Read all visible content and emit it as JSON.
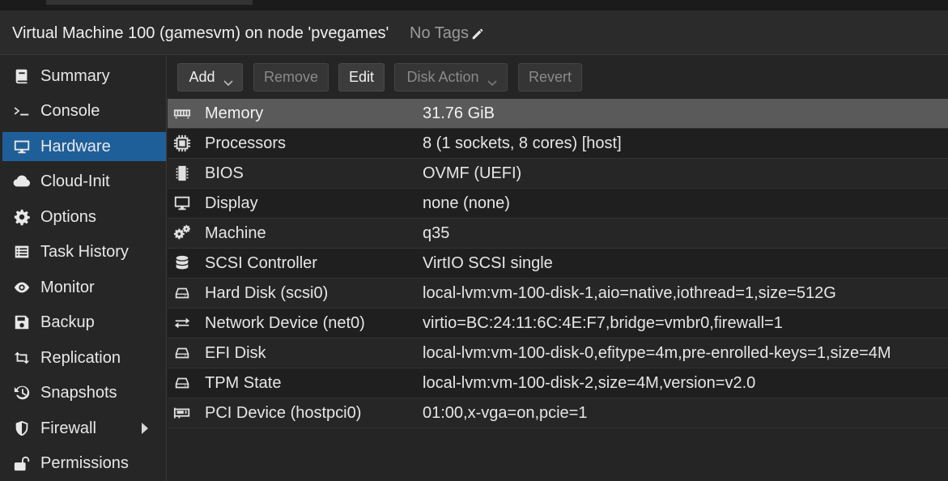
{
  "window": {
    "title": "Virtual Machine 100 (gamesvm) on node 'pvegames'",
    "tags_label": "No Tags"
  },
  "sidebar": {
    "items": [
      {
        "label": "Summary",
        "icon": "book-icon"
      },
      {
        "label": "Console",
        "icon": "terminal-icon"
      },
      {
        "label": "Hardware",
        "icon": "monitor-icon",
        "active": true
      },
      {
        "label": "Cloud-Init",
        "icon": "cloud-icon"
      },
      {
        "label": "Options",
        "icon": "gear-icon"
      },
      {
        "label": "Task History",
        "icon": "list-icon"
      },
      {
        "label": "Monitor",
        "icon": "eye-icon"
      },
      {
        "label": "Backup",
        "icon": "floppy-icon"
      },
      {
        "label": "Replication",
        "icon": "retweet-icon"
      },
      {
        "label": "Snapshots",
        "icon": "history-icon"
      },
      {
        "label": "Firewall",
        "icon": "shield-icon",
        "expandable": true
      },
      {
        "label": "Permissions",
        "icon": "unlock-icon"
      }
    ]
  },
  "toolbar": {
    "add_label": "Add",
    "remove_label": "Remove",
    "edit_label": "Edit",
    "disk_action_label": "Disk Action",
    "revert_label": "Revert"
  },
  "hardware": {
    "rows": [
      {
        "key": "Memory",
        "value": "31.76 GiB",
        "icon": "memory-icon",
        "selected": true
      },
      {
        "key": "Processors",
        "value": "8 (1 sockets, 8 cores) [host]",
        "icon": "cpu-icon"
      },
      {
        "key": "BIOS",
        "value": "OVMF (UEFI)",
        "icon": "chip-icon"
      },
      {
        "key": "Display",
        "value": "none (none)",
        "icon": "desktop-icon"
      },
      {
        "key": "Machine",
        "value": "q35",
        "icon": "cogs-icon"
      },
      {
        "key": "SCSI Controller",
        "value": "VirtIO SCSI single",
        "icon": "database-icon"
      },
      {
        "key": "Hard Disk (scsi0)",
        "value": "local-lvm:vm-100-disk-1,aio=native,iothread=1,size=512G",
        "icon": "hdd-icon"
      },
      {
        "key": "Network Device (net0)",
        "value": "virtio=BC:24:11:6C:4E:F7,bridge=vmbr0,firewall=1",
        "icon": "exchange-icon"
      },
      {
        "key": "EFI Disk",
        "value": "local-lvm:vm-100-disk-0,efitype=4m,pre-enrolled-keys=1,size=4M",
        "icon": "hdd-icon"
      },
      {
        "key": "TPM State",
        "value": "local-lvm:vm-100-disk-2,size=4M,version=v2.0",
        "icon": "hdd-icon"
      },
      {
        "key": "PCI Device (hostpci0)",
        "value": "01:00,x-vga=on,pcie=1",
        "icon": "pci-card-icon"
      }
    ]
  },
  "colors": {
    "active_nav": "#1f5f99",
    "selected_row": "#5a5a5a"
  }
}
